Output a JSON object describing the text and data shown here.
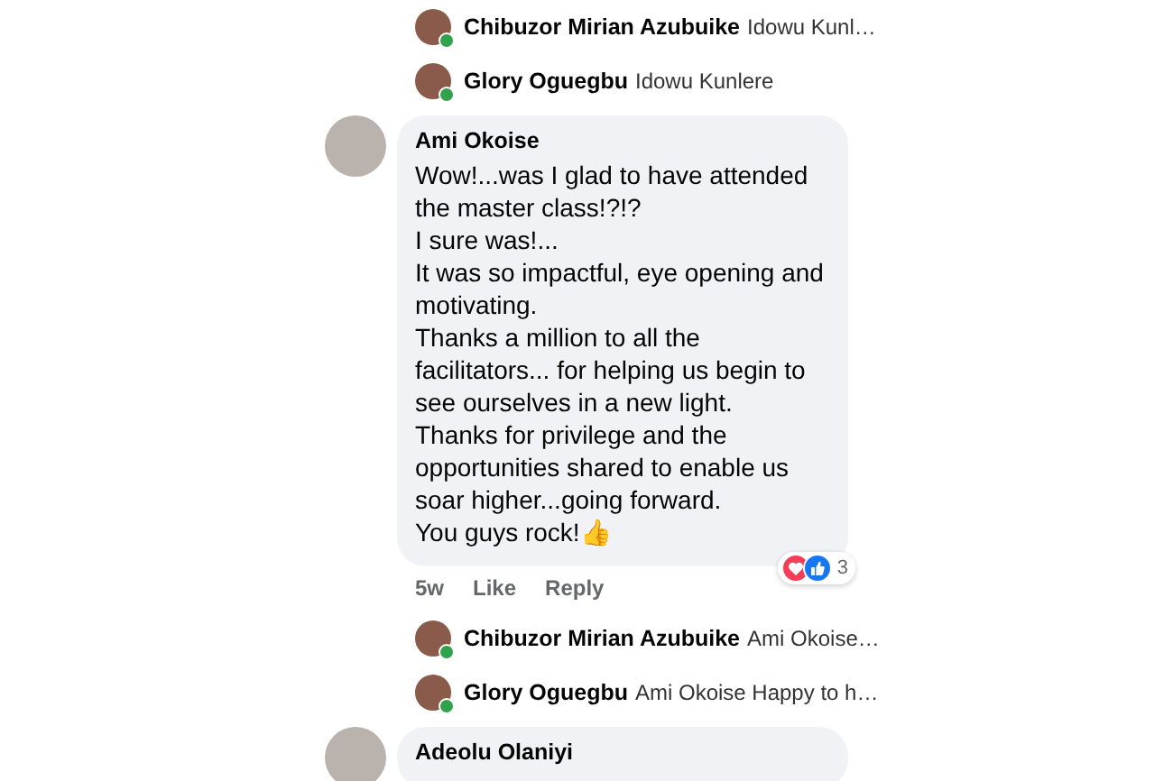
{
  "items": [
    {
      "kind": "reply",
      "author": "Chibuzor Mirian Azubuike",
      "snippet": "Idowu Kunl…",
      "online": true
    },
    {
      "kind": "reply",
      "author": "Glory Oguegbu",
      "snippet": "Idowu Kunlere",
      "online": true
    },
    {
      "kind": "comment",
      "author": "Ami Okoise",
      "paragraphs": [
        "Wow!...was I glad to have attended the master class!?!?",
        "I sure was!...",
        "It was so impactful, eye opening and motivating.",
        "Thanks a million to all the facilitators... for helping us begin to see ourselves in a new light.",
        "Thanks for privilege and the opportunities shared to enable us soar higher...going forward.",
        "You guys rock!👍"
      ],
      "time": "5w",
      "actions": [
        "Like",
        "Reply"
      ],
      "reaction_count": "3"
    },
    {
      "kind": "reply",
      "author": "Chibuzor Mirian Azubuike",
      "snippet": "Ami Okoise…",
      "online": true
    },
    {
      "kind": "reply",
      "author": "Glory Oguegbu",
      "snippet": "Ami Okoise Happy to h…",
      "online": true
    },
    {
      "kind": "comment",
      "author": "Adeolu Olaniyi"
    }
  ]
}
